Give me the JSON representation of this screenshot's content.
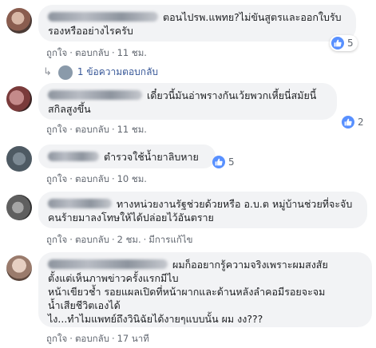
{
  "accent_color": "#5890ff",
  "comments": [
    {
      "text": "ตอนไปรพ.แพทย?ไม่ขันสูตรและออกใบรับรองหรืออย่างไรครับ",
      "like_label": "ถูกใจ",
      "reply_label": "ตอบกลับ",
      "time": "11 ชม.",
      "likes": "5",
      "reaction_icon": "thumbs-up-icon",
      "replies_label": "1 ข้อความตอบกลับ"
    },
    {
      "text": "เดี๋ยวนี้มันอ่าพรางกันเว้ยพวกเหี้ยนี่สมัยนี้สกิลสูงขึ้น",
      "like_label": "ถูกใจ",
      "reply_label": "ตอบกลับ",
      "time": "11 ชม.",
      "likes": "2",
      "reaction_icon": "thumbs-up-icon"
    },
    {
      "text": "ตำรวจใช้น้ำยาลิบหาย",
      "like_label": "ถูกใจ",
      "reply_label": "ตอบกลับ",
      "time": "10 ชม.",
      "likes": "5",
      "reaction_icon": "thumbs-up-icon"
    },
    {
      "text": "ทางหน่วยงานรัฐช่วยด้วยหรือ อ.บ.ต หมู่บ้านช่วยที่จะจับคนร้ายมาลงโทษให้ได้ปล่อยไว้อันตราย",
      "like_label": "ถูกใจ",
      "reply_label": "ตอบกลับ",
      "time": "2 ชม.",
      "edited_label": "มีการแก้ไข"
    },
    {
      "text": "ผมก็ออยากรู้ความจริงเพราะผมสงสัย\nตั้งแต่เห็นภาพข่าวครั้งแรกมีไบ\nหน้าเขียวช้ำ รอยแผลเปิดที่หน้าผากและด้านหลังลำคอมีรอยจะจม\nน้ำเสียชีวิตเองได้\nไง...ทำไมแพทย์ถึงวินิฉัยได้งายๆแบบนั้น ผม งง???",
      "like_label": "ถูกใจ",
      "reply_label": "ตอบกลับ",
      "time": "17 นาที"
    }
  ]
}
